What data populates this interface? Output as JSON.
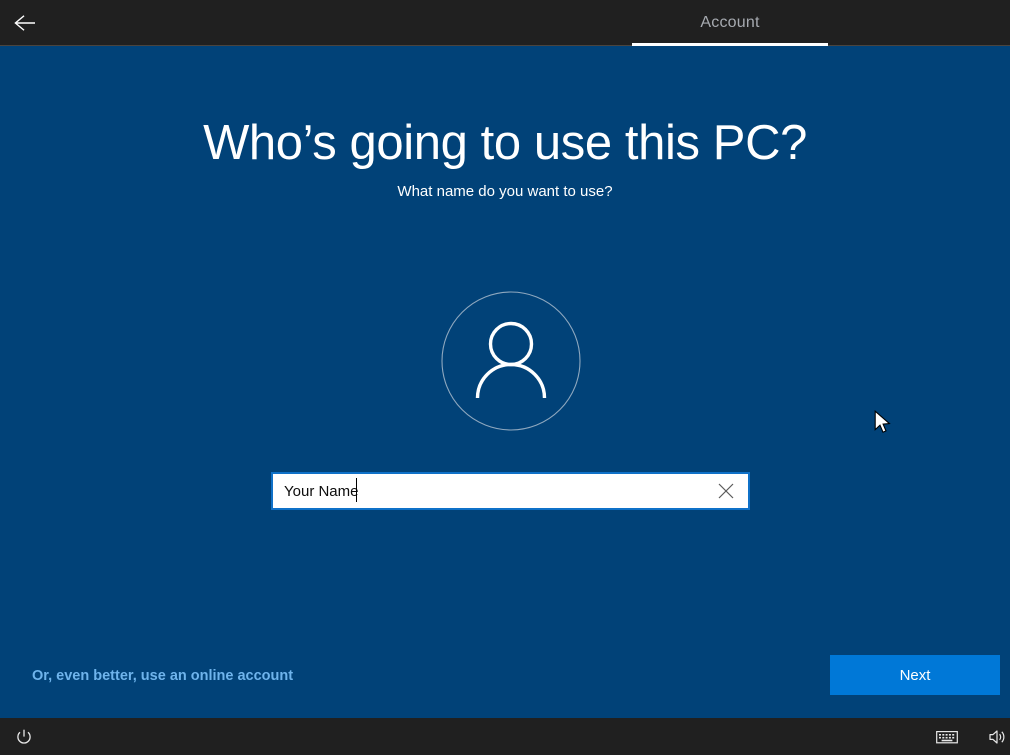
{
  "header": {
    "back_icon": "back-arrow-icon",
    "tabs": [
      {
        "label": "Account",
        "selected": true
      }
    ]
  },
  "main": {
    "title": "Who’s going to use this PC?",
    "subtitle": "What name do you want to use?",
    "avatar_icon": "user-avatar-icon",
    "name_field": {
      "value": "Your Name",
      "placeholder": "",
      "clear_icon": "close-x-icon",
      "focused": true
    }
  },
  "footer": {
    "online_account_link": "Or, even better, use an online account",
    "next_label": "Next"
  },
  "taskbar": {
    "power_icon": "power-icon",
    "keyboard_icon": "keyboard-icon",
    "volume_icon": "volume-icon"
  },
  "colors": {
    "background": "#014278",
    "header": "#202020",
    "accent": "#0078d7",
    "focus_border": "#0f71c8",
    "link": "#6fb4ec",
    "tab_text": "#a6aab0"
  }
}
